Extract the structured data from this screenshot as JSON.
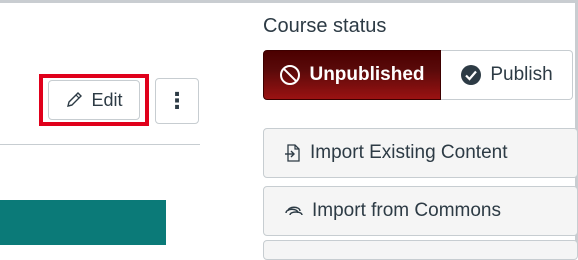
{
  "header": {
    "edit_label": "Edit",
    "more_options": "⋮"
  },
  "status": {
    "title": "Course status",
    "unpublished_label": "Unpublished",
    "publish_label": "Publish"
  },
  "actions": [
    {
      "label": "Import Existing Content",
      "icon": "import-icon"
    },
    {
      "label": "Import from Commons",
      "icon": "commons-icon"
    }
  ],
  "colors": {
    "highlight": "#e0001b",
    "unpublished_bg": "#5a0a0a",
    "teal_card": "#0b7a78"
  }
}
